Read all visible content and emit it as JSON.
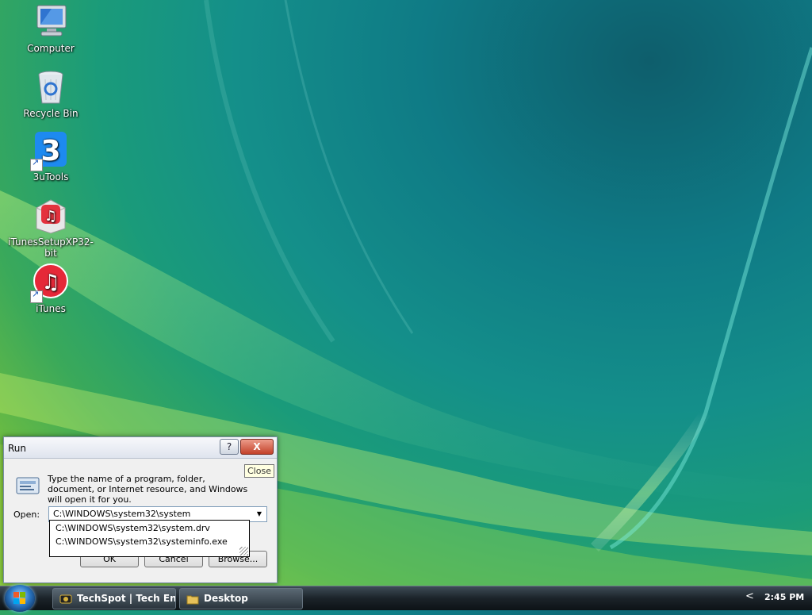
{
  "desktop": {
    "icons": [
      {
        "label": "Computer",
        "icon": "computer-icon"
      },
      {
        "label": "Recycle Bin",
        "icon": "recycle-bin-icon"
      },
      {
        "label": "3uTools",
        "icon": "3utools-icon",
        "glyph": "3"
      },
      {
        "label": "iTunesSetupXP32-bit",
        "icon": "itunes-setup-icon"
      },
      {
        "label": "iTunes",
        "icon": "itunes-icon"
      }
    ]
  },
  "run_dialog": {
    "title": "Run",
    "help_label": "?",
    "close_label": "X",
    "description": "Type the name of a program, folder, document, or Internet resource, and Windows will open it for you.",
    "open_label": "Open:",
    "open_value": "C:\\WINDOWS\\system32\\system",
    "buttons": {
      "ok": "OK",
      "cancel": "Cancel",
      "browse": "Browse..."
    }
  },
  "tooltip": {
    "text": "Close"
  },
  "autocomplete": {
    "items": [
      "C:\\WINDOWS\\system32\\system.drv",
      "C:\\WINDOWS\\system32\\systeminfo.exe"
    ]
  },
  "taskbar": {
    "buttons": [
      {
        "label": "TechSpot | Tech Ent...",
        "icon": "techspot-icon"
      },
      {
        "label": "Desktop",
        "icon": "folder-icon"
      }
    ],
    "tray_chevron": "<",
    "clock": "2:45 PM"
  },
  "colors": {
    "wallpaper_dark": "#0e5e6c",
    "wallpaper_green": "#7cc23a",
    "close_red": "#c3422a",
    "tooltip_bg": "#ffffe1"
  }
}
